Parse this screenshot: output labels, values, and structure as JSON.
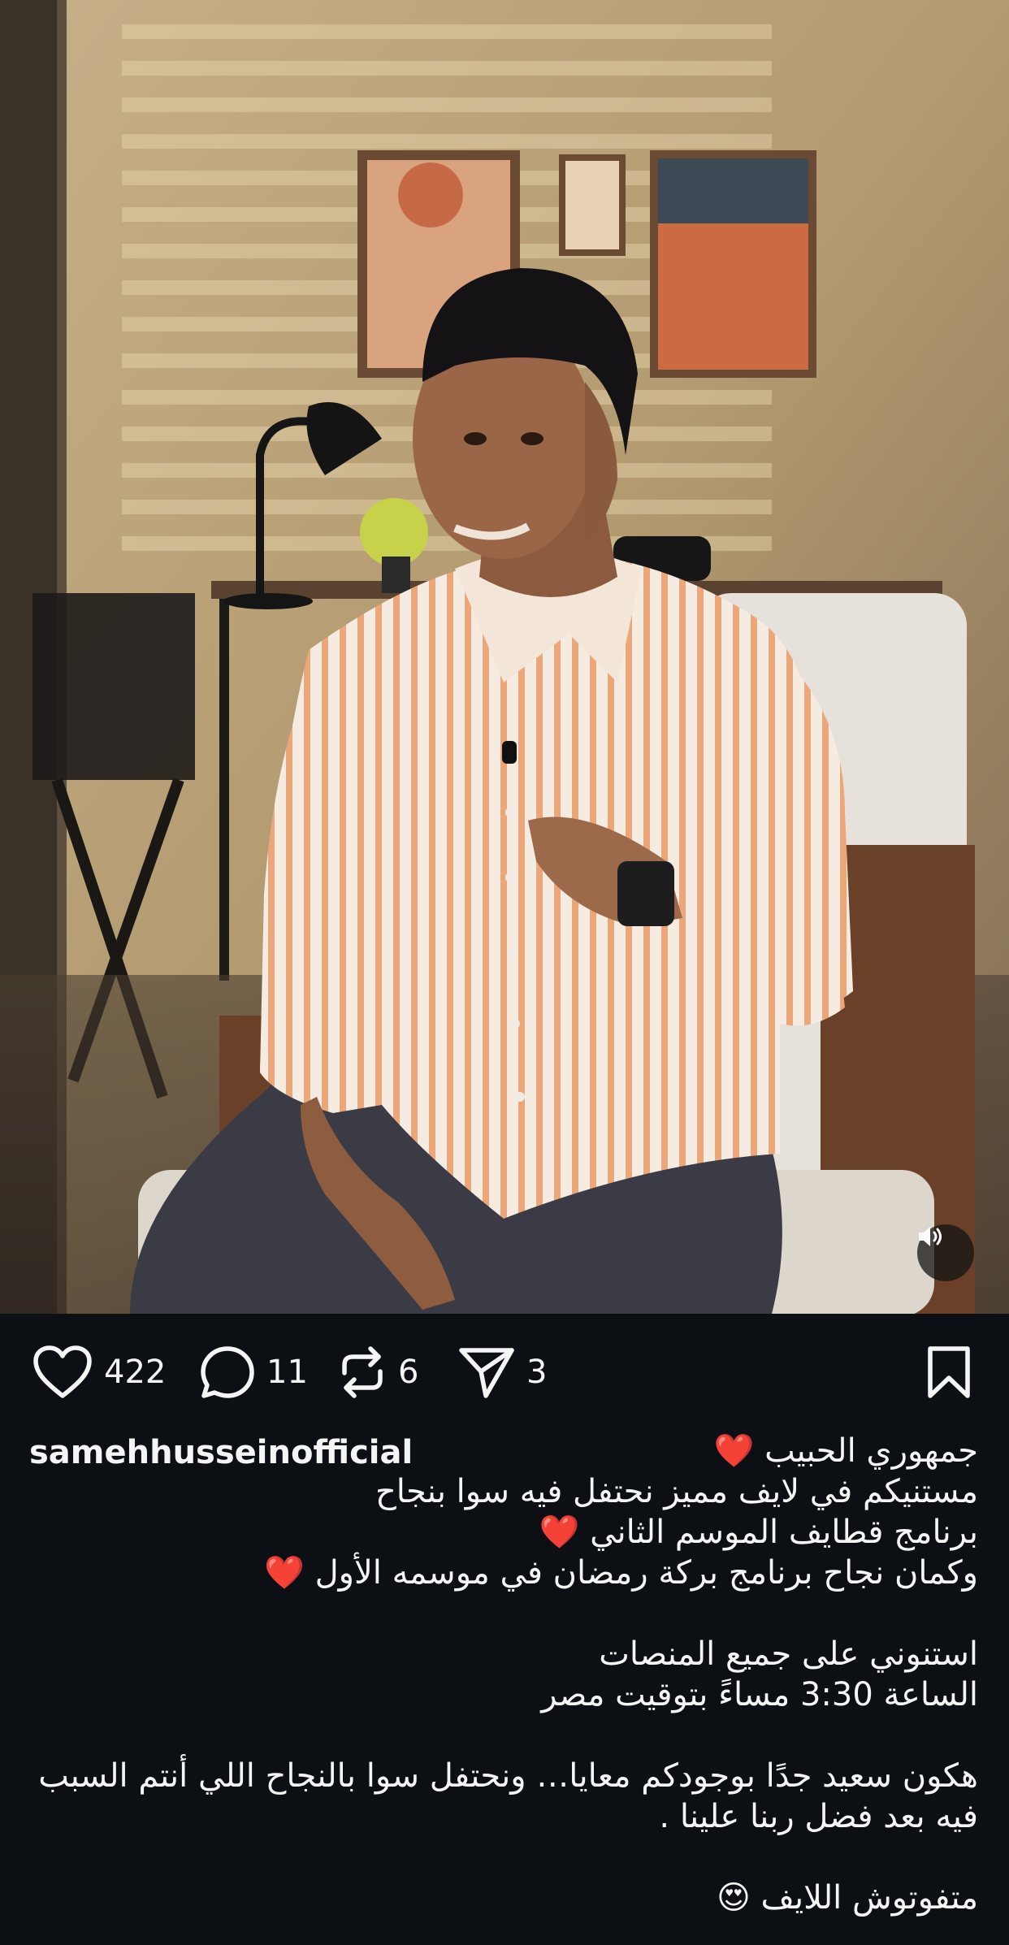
{
  "post": {
    "username": "samehhusseinofficial"
  },
  "actions": {
    "likes": "422",
    "comments": "11",
    "reposts": "6",
    "shares": "3"
  },
  "caption": {
    "line1": "جمهوري الحبيب ❤️",
    "line2": "مستنيكم في لايف مميز نحتفل فيه سوا بنجاح",
    "line3": "برنامج قطايف الموسم الثاني ❤️",
    "line4": "وكمان نجاح برنامج بركة رمضان في موسمه الأول ❤️",
    "line5": "استنوني على جميع المنصات",
    "line6": "الساعة 3:30 مساءً بتوقيت مصر",
    "line7": "هكون سعيد جدًا بوجودكم معايا… ونحتفل سوا بالنجاح اللي أنتم السبب",
    "line8": "فيه بعد فضل ربنا علينا .",
    "line9": "متفوتوش اللايف 😍"
  },
  "icons": {
    "like": "heart-icon",
    "comment": "comment-icon",
    "repost": "repost-icon",
    "share": "send-icon",
    "save": "bookmark-icon",
    "sound": "speaker-icon"
  },
  "colors": {
    "background": "#0c1014",
    "text": "#f5f5f5",
    "heart": "#e0181f"
  }
}
